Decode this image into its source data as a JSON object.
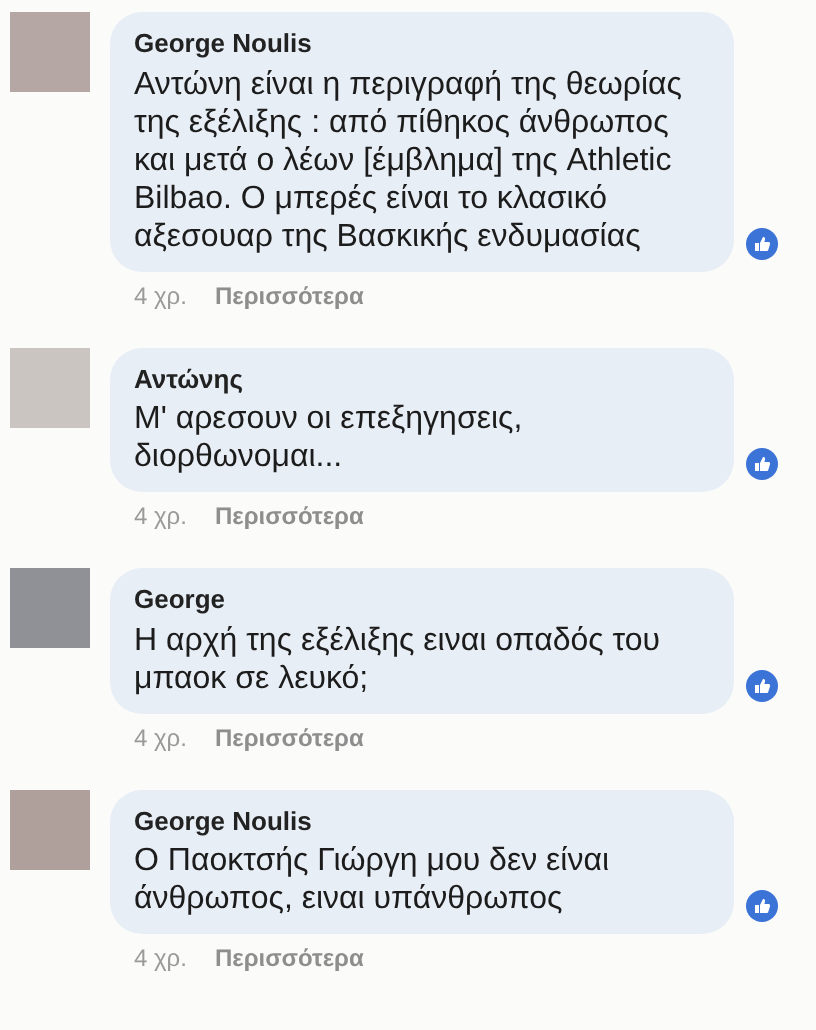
{
  "comments": [
    {
      "author": "George Noulis",
      "color": "#b5a8a4",
      "text": "Αντώνη είναι η περιγραφή της θεωρίας της εξέλιξης : από πίθηκος άνθρωπος και μετά ο λέων [έμβλημα] της Athletic Bilbao. O μπερές είναι το κλασικό αξεσουαρ της Βασκικής ενδυμασίας",
      "time": "4 χρ.",
      "action": "Περισσότερα"
    },
    {
      "author": "Αντώνης",
      "color": "#cac5c0",
      "text": "Μ' αρεσουν οι επεξηγησεις, διορθωνομαι...",
      "time": "4 χρ.",
      "action": "Περισσότερα"
    },
    {
      "author": "George",
      "color": "#8f9196",
      "text": "Η αρχή της εξέλιξης ειναι οπαδός του μπαοκ σε λευκό;",
      "time": "4 χρ.",
      "action": "Περισσότερα"
    },
    {
      "author": "George Noulis",
      "color": "#b0a09c",
      "text": "Ο Παοκτσής Γιώργη μου δεν είναι άνθρωπος, ειναι υπάνθρωπος",
      "time": "4 χρ.",
      "action": "Περισσότερα"
    }
  ]
}
